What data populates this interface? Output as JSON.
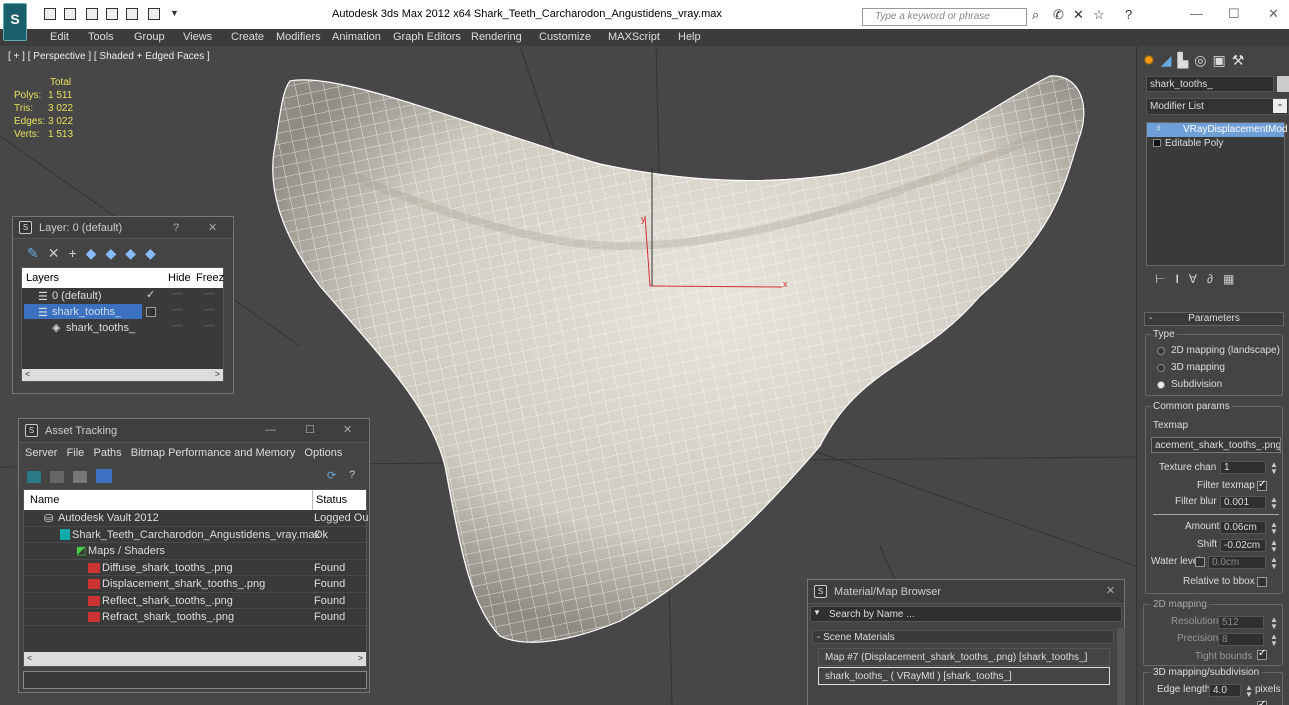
{
  "titlebar": {
    "logo": "S",
    "title": "Autodesk 3ds Max  2012 x64      Shark_Teeth_Carcharodon_Angustidens_vray.max",
    "search_placeholder": "Type a keyword or phrase"
  },
  "menu": [
    "Edit",
    "Tools",
    "Group",
    "Views",
    "Create",
    "Modifiers",
    "Animation",
    "Graph Editors",
    "Rendering",
    "Customize",
    "MAXScript",
    "Help"
  ],
  "viewport": {
    "label": "[ + ] [ Perspective ] [ Shaded + Edged Faces ]",
    "stats_header": "Total",
    "stats": [
      {
        "k": "Polys:",
        "v": "1 511"
      },
      {
        "k": "Tris:",
        "v": "3 022"
      },
      {
        "k": "Edges:",
        "v": "3 022"
      },
      {
        "k": "Verts:",
        "v": "1 513"
      }
    ],
    "gizmo_x": "x",
    "gizmo_y": "y"
  },
  "layer_dialog": {
    "title": "Layer: 0 (default)",
    "help": "?",
    "close": "✕",
    "col_layers": "Layers",
    "col_hide": "Hide",
    "col_freeze": "Freeze",
    "rows": [
      "0 (default)",
      "shark_tooths_",
      "shark_tooths_"
    ],
    "dash": "----"
  },
  "asset_tracking": {
    "title": "Asset Tracking",
    "menus": [
      "Server",
      "File",
      "Paths",
      "Bitmap Performance and Memory",
      "Options"
    ],
    "col_name": "Name",
    "col_status": "Status",
    "rows": [
      {
        "name": "Autodesk Vault 2012",
        "status": "Logged Ou"
      },
      {
        "name": "Shark_Teeth_Carcharodon_Angustidens_vray.max",
        "status": "Ok"
      },
      {
        "name": "Maps / Shaders",
        "status": ""
      },
      {
        "name": "Diffuse_shark_tooths_.png",
        "status": "Found"
      },
      {
        "name": "Displacement_shark_tooths_.png",
        "status": "Found"
      },
      {
        "name": "Reflect_shark_tooths_.png",
        "status": "Found"
      },
      {
        "name": "Refract_shark_tooths_.png",
        "status": "Found"
      }
    ]
  },
  "material_browser": {
    "title": "Material/Map Browser",
    "search": "Search by Name ...",
    "section": "- Scene Materials",
    "items": [
      "Map #7 (Displacement_shark_tooths_.png) [shark_tooths_]",
      "shark_tooths_  ( VRayMtl ) [shark_tooths_]"
    ]
  },
  "command_panel": {
    "object_name": "shark_tooths_",
    "modifier_list": "Modifier List",
    "stack": [
      "VRayDisplacementMod",
      "Editable Poly"
    ],
    "rollout_title": "Parameters",
    "type_label": "Type",
    "type_options": [
      "2D mapping (landscape)",
      "3D mapping",
      "Subdivision"
    ],
    "type_selected": "Subdivision",
    "common_params": "Common params",
    "texmap_label": "Texmap",
    "texmap_value": "acement_shark_tooths_.png)",
    "texture_chan_label": "Texture chan",
    "texture_chan_value": "1",
    "filter_texmap_label": "Filter texmap",
    "filter_blur_label": "Filter blur",
    "filter_blur_value": "0.001",
    "amount_label": "Amount",
    "amount_value": "0.06cm",
    "shift_label": "Shift",
    "shift_value": "-0.02cm",
    "water_level_label": "Water level",
    "water_level_value": "0.0cm",
    "relative_bbox_label": "Relative to bbox",
    "mapping2d_label": "2D mapping",
    "resolution_label": "Resolution",
    "resolution_value": "512",
    "precision_label": "Precision",
    "precision_value": "8",
    "tight_bounds_label": "Tight bounds",
    "mapping3d_label": "3D mapping/subdivision",
    "edge_length_label": "Edge length",
    "edge_length_value": "4.0",
    "pixels_label": "pixels"
  }
}
